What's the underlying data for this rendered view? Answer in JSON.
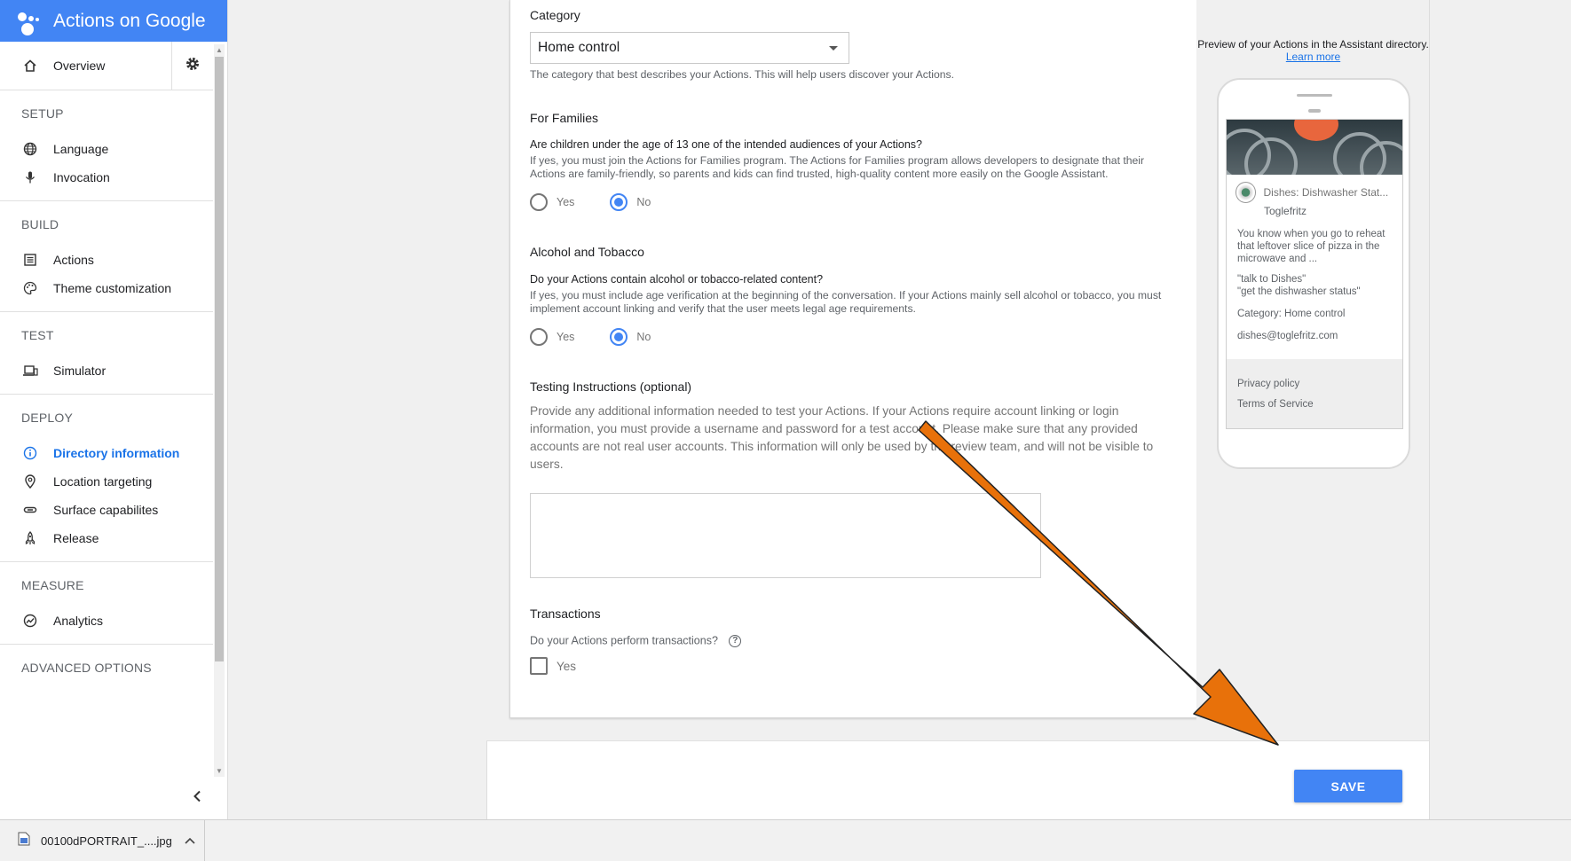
{
  "app": {
    "title": "Actions on Google"
  },
  "sidebar": {
    "overview": "Overview",
    "sections": {
      "setup": {
        "title": "SETUP",
        "items": [
          "Language",
          "Invocation"
        ]
      },
      "build": {
        "title": "BUILD",
        "items": [
          "Actions",
          "Theme customization"
        ]
      },
      "test": {
        "title": "TEST",
        "items": [
          "Simulator"
        ]
      },
      "deploy": {
        "title": "DEPLOY",
        "items": [
          "Directory information",
          "Location targeting",
          "Surface capabilites",
          "Release"
        ]
      },
      "measure": {
        "title": "MEASURE",
        "items": [
          "Analytics"
        ]
      },
      "advanced": {
        "title": "ADVANCED OPTIONS"
      }
    },
    "active_item": "Directory information"
  },
  "form": {
    "category": {
      "label": "Category",
      "value": "Home control",
      "help": "The category that best describes your Actions. This will help users discover your Actions."
    },
    "families": {
      "label": "For Families",
      "question": "Are children under the age of 13 one of the intended audiences of your Actions?",
      "help": "If yes, you must join the Actions for Families program. The Actions for Families program allows developers to designate that their Actions are family-friendly, so parents and kids can find trusted, high-quality content more easily on the Google Assistant.",
      "yes": "Yes",
      "no": "No",
      "selected": "No"
    },
    "alcohol": {
      "label": "Alcohol and Tobacco",
      "question": "Do your Actions contain alcohol or tobacco-related content?",
      "help": "If yes, you must include age verification at the beginning of the conversation. If your Actions mainly sell alcohol or tobacco, you must implement account linking and verify that the user meets legal age requirements.",
      "yes": "Yes",
      "no": "No",
      "selected": "No"
    },
    "testing": {
      "label": "Testing Instructions (optional)",
      "help": "Provide any additional information needed to test your Actions. If your Actions require account linking or login information, you must provide a username and password for a test account. Please make sure that any provided accounts are not real user accounts. This information will only be used by the review team, and will not be visible to users.",
      "value": ""
    },
    "transactions": {
      "label": "Transactions",
      "question": "Do your Actions perform transactions?",
      "checkbox_label": "Yes",
      "checked": false
    }
  },
  "footer": {
    "save_label": "SAVE"
  },
  "preview": {
    "caption": "Preview of your Actions in the Assistant directory.",
    "learn_more": "Learn more",
    "app_title": "Dishes: Dishwasher Stat...",
    "developer": "Toglefritz",
    "description": "You know when you go to reheat that leftover slice of pizza in the microwave and ...",
    "invocation_1": "\"talk to Dishes\"",
    "invocation_2": "\"get the dishwasher status\"",
    "category_line": "Category: Home control",
    "email": "dishes@toglefritz.com",
    "privacy": "Privacy policy",
    "terms": "Terms of Service"
  },
  "download_bar": {
    "file_name": "00100dPORTRAIT_....jpg"
  },
  "colors": {
    "brand": "#4285f4",
    "annotation_arrow": "#e8710a"
  }
}
